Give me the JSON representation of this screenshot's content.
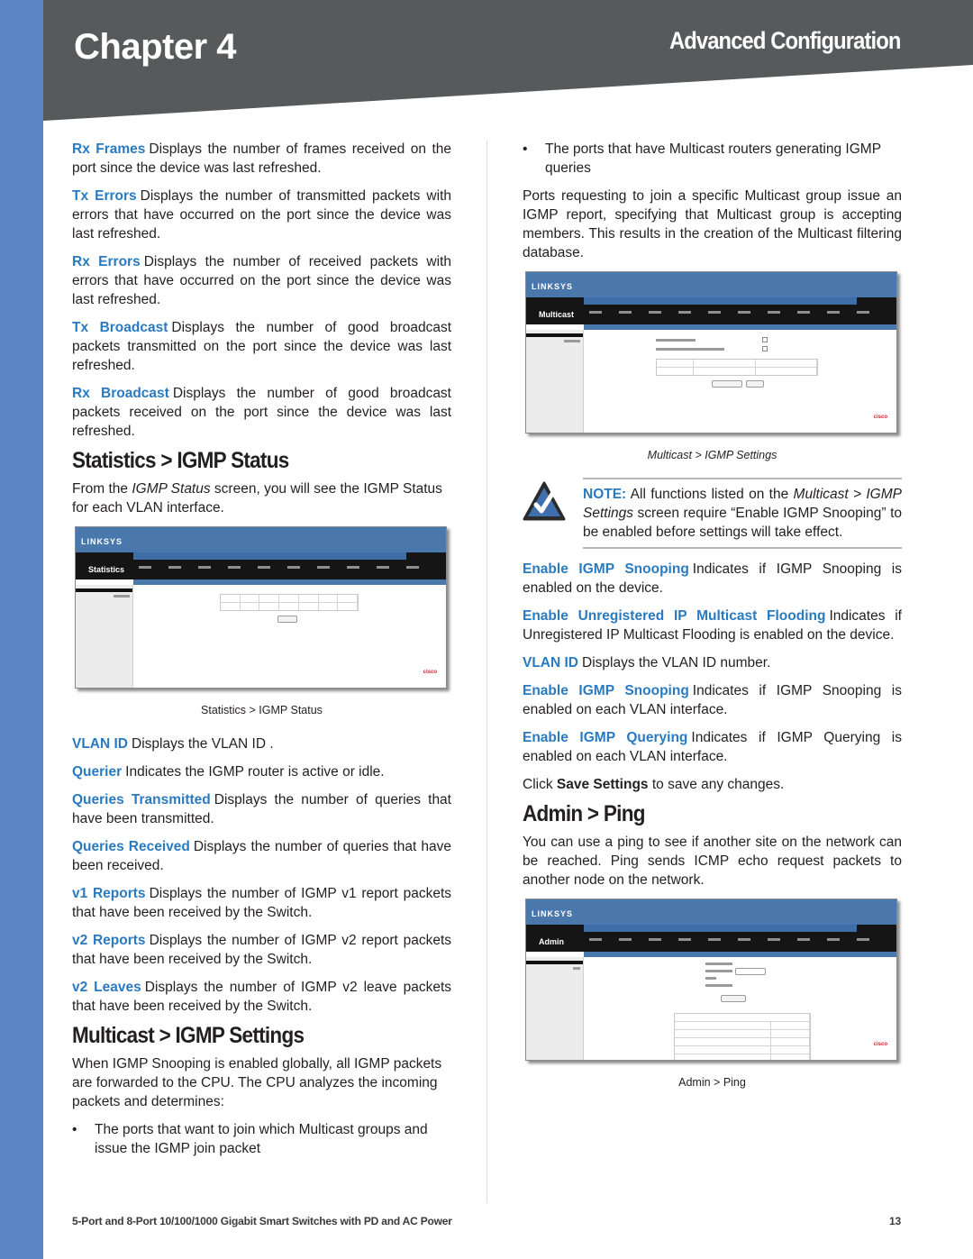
{
  "header": {
    "chapter": "Chapter 4",
    "section": "Advanced Configuration",
    "colors": {
      "banner": "#58595b",
      "strip": "#5b86c5",
      "accent": "#2a7ac0"
    }
  },
  "left": {
    "intro_items": [
      {
        "term": "Rx Frames",
        "text": "Displays the number of frames received on the port since the device was last refreshed."
      },
      {
        "term": "Tx Errors",
        "text": "Displays the number of transmitted packets with errors that have occurred on the port since the device was last refreshed."
      },
      {
        "term": "Rx Errors",
        "text": "Displays the number of received packets with errors that have occurred on the port since the device was last refreshed."
      },
      {
        "term": "Tx Broadcast",
        "text": "Displays the number of good broadcast packets transmitted on the port since the device was last refreshed."
      },
      {
        "term": "Rx Broadcast",
        "text": "Displays the number of good broadcast packets received on the port since the device was last refreshed."
      }
    ],
    "igmp_status": {
      "heading": "Statistics > IGMP Status",
      "intro_prefix": "From the ",
      "intro_italic": "IGMP Status",
      "intro_suffix": " screen, you will see the IGMP Status for each VLAN interface.",
      "figure": {
        "module_label": "Statistics",
        "logo": "LINKSYS",
        "brand": "cisco",
        "caption": "Statistics > IGMP Status"
      },
      "items": [
        {
          "term": "VLAN ID",
          "text": "Displays the VLAN ID ."
        },
        {
          "term": "Querier",
          "text": "Indicates the IGMP router is active or idle."
        },
        {
          "term": "Queries Transmitted",
          "text": "Displays the number of queries that have been transmitted."
        },
        {
          "term": "Queries Received",
          "text": "Displays the number of queries that have been received."
        },
        {
          "term": "v1 Reports",
          "text": "Displays the number of IGMP v1 report packets that have been received by the Switch."
        },
        {
          "term": "v2 Reports",
          "text": "Displays the number of IGMP v2 report packets that have been received by the Switch."
        },
        {
          "term": "v2 Leaves",
          "text": "Displays the number of IGMP v2 leave packets that have been received by the Switch."
        }
      ]
    },
    "igmp_settings": {
      "heading": "Multicast > IGMP Settings",
      "intro": "When IGMP Snooping is enabled globally, all IGMP packets are forwarded to the CPU. The CPU analyzes the incoming packets and determines:",
      "bullets": [
        "The ports that want to join which Multicast groups and issue the IGMP join packet"
      ]
    }
  },
  "right": {
    "bullets": [
      "The ports that have Multicast routers generating IGMP queries"
    ],
    "paragraph": "Ports requesting to join a specific Multicast group issue an IGMP report, specifying that Multicast group is accepting members. This results in the creation of the Multicast filtering database.",
    "figure": {
      "module_label": "Multicast",
      "logo": "LINKSYS",
      "brand": "cisco",
      "caption": "Multicast > IGMP Settings"
    },
    "note": {
      "label": "NOTE:",
      "text_1": " All functions listed on the ",
      "italic": "Multicast > IGMP Settings",
      "text_2": " screen require “Enable IGMP Snooping” to be enabled before settings will take effect."
    },
    "items": [
      {
        "term": "Enable IGMP Snooping",
        "text": "Indicates if IGMP Snooping is enabled on the device."
      },
      {
        "term": "Enable Unregistered IP Multicast Flooding",
        "text": "Indicates if Unregistered IP Multicast Flooding is enabled on the device."
      },
      {
        "term": "VLAN ID",
        "text": "Displays the VLAN ID number."
      },
      {
        "term": "Enable IGMP Snooping",
        "text": "Indicates if IGMP Snooping is enabled on each VLAN interface."
      },
      {
        "term": "Enable IGMP Querying",
        "text": "Indicates if IGMP Querying is enabled on each VLAN interface."
      }
    ],
    "save": {
      "prefix": "Click ",
      "bold": "Save Settings",
      "suffix": " to save any changes."
    },
    "ping": {
      "heading": "Admin > Ping",
      "text": "You can use a ping to see if another site on the network can be reached. Ping sends ICMP echo request packets to another node on the network.",
      "figure": {
        "module_label": "Admin",
        "logo": "LINKSYS",
        "brand": "cisco",
        "caption": "Admin > Ping"
      }
    }
  },
  "footer": {
    "title": "5-Port and 8-Port 10/100/1000 Gigabit Smart Switches with PD and AC Power",
    "page": "13"
  }
}
